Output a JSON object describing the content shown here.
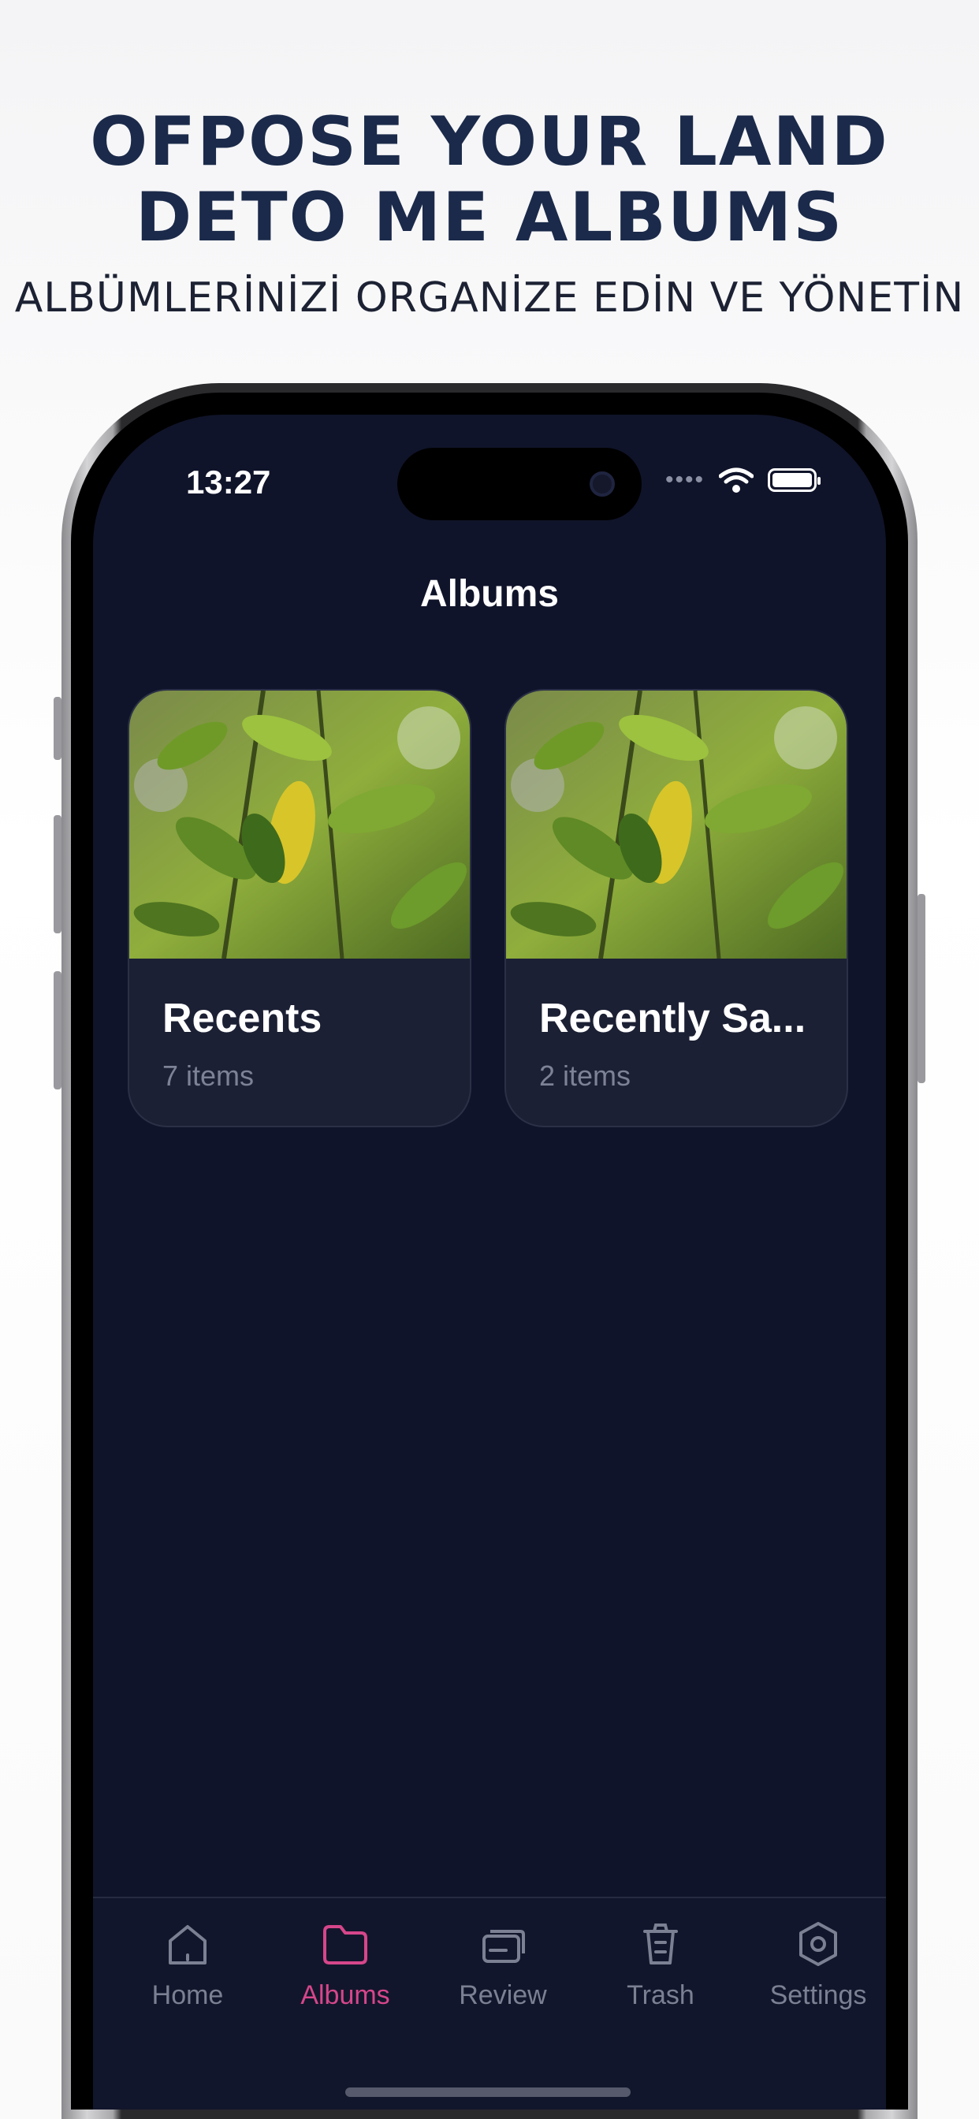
{
  "marketing": {
    "headline_line1": "OFPOSE YOUR LAND",
    "headline_line2": "DETO ME ALBUMS",
    "subheadline": "ALBÜMLERİNİZİ ORGANİZE EDİN VE YÖNETİN"
  },
  "status_bar": {
    "time": "13:27",
    "signal_dots": "••••"
  },
  "screen": {
    "title": "Albums"
  },
  "albums": [
    {
      "title": "Recents",
      "count": "7 items",
      "thumbnail": "leaf-photo"
    },
    {
      "title": "Recently Sa...",
      "count": "2 items",
      "thumbnail": "leaf-photo"
    }
  ],
  "tabbar": {
    "tabs": [
      {
        "label": "Home",
        "icon": "home-icon",
        "active": false
      },
      {
        "label": "Albums",
        "icon": "folder-icon",
        "active": true
      },
      {
        "label": "Review",
        "icon": "cards-icon",
        "active": false
      },
      {
        "label": "Trash",
        "icon": "trash-icon",
        "active": false
      },
      {
        "label": "Settings",
        "icon": "gear-icon",
        "active": false
      }
    ]
  },
  "colors": {
    "screen_background": "#10142a",
    "card_background": "#1c2034",
    "active_tab": "#d6468b",
    "inactive_tab": "#7b8093",
    "headline": "#1b2a4a"
  }
}
